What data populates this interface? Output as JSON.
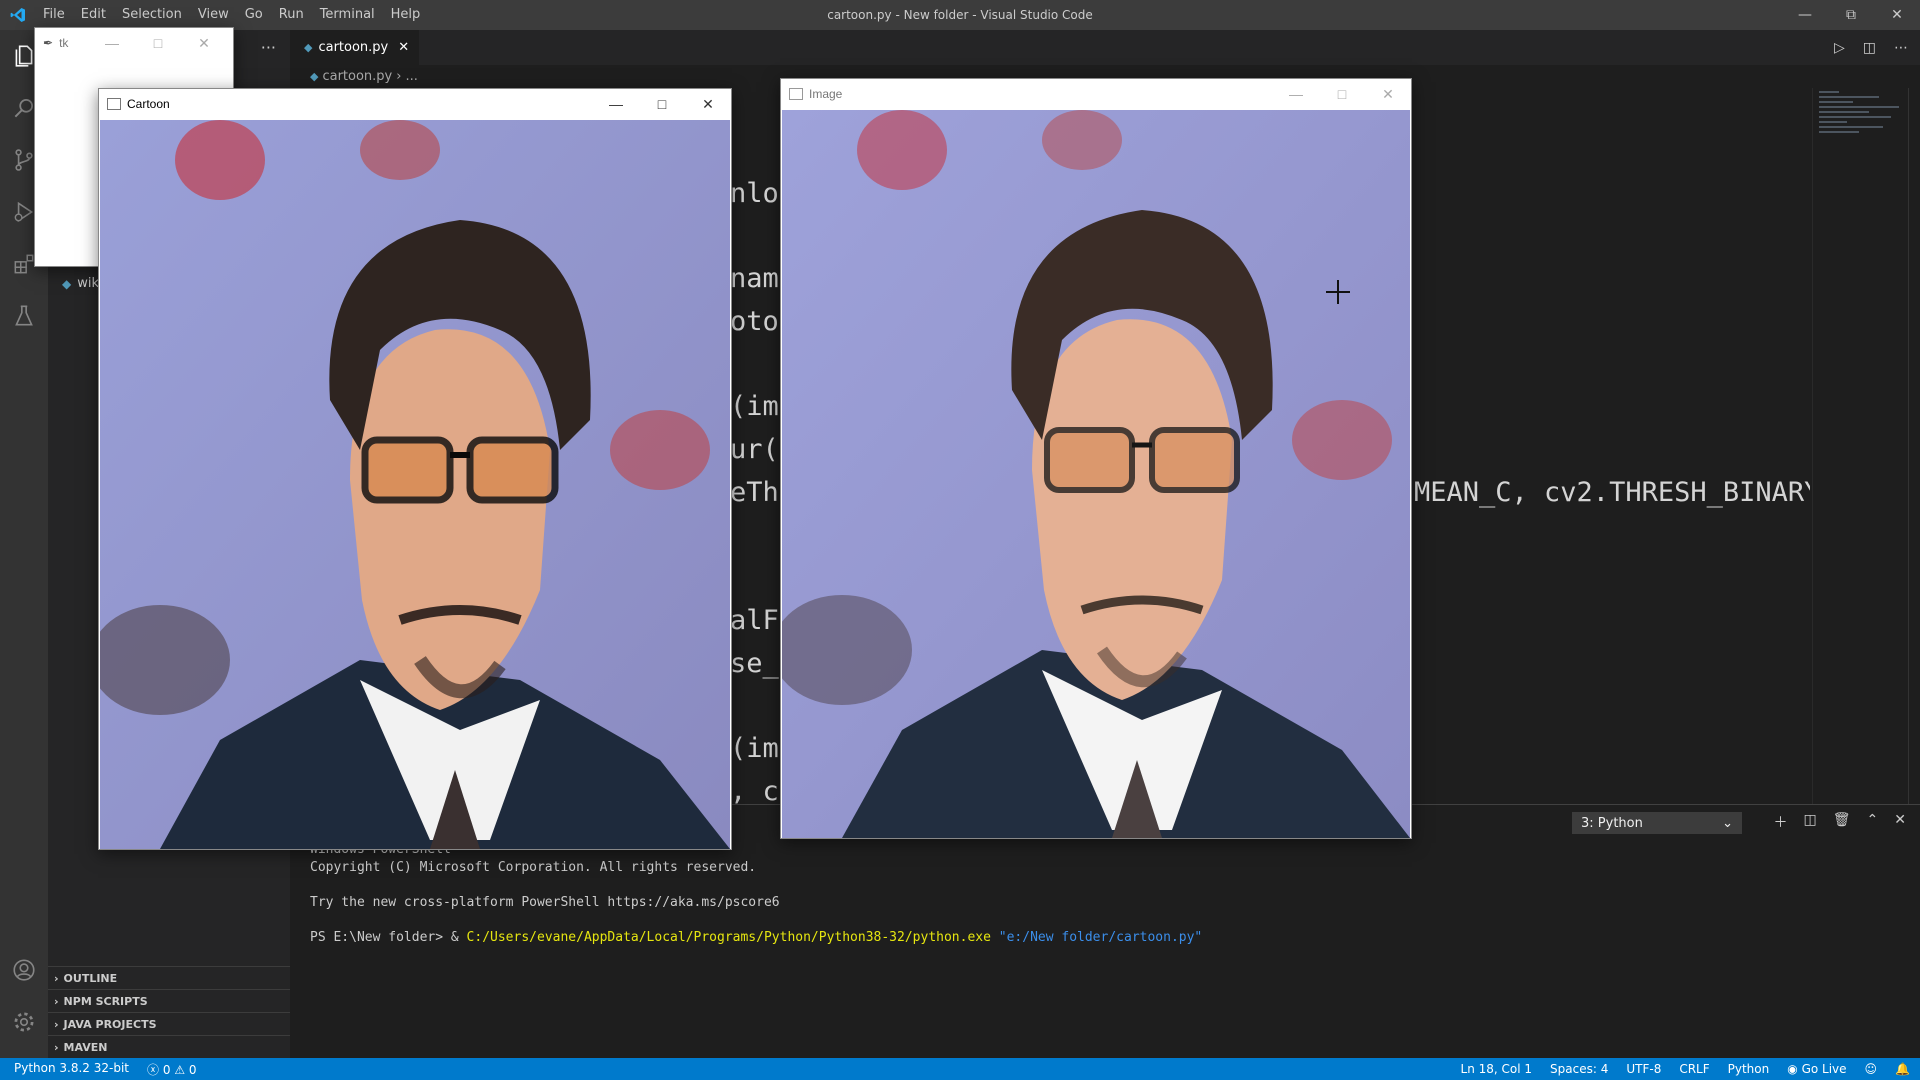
{
  "titlebar": {
    "title": "cartoon.py - New folder - Visual Studio Code",
    "menu": [
      "File",
      "Edit",
      "Selection",
      "View",
      "Go",
      "Run",
      "Terminal",
      "Help"
    ]
  },
  "sidebar": {
    "more": "···",
    "wiki_item": "wik",
    "sections": [
      "OUTLINE",
      "NPM SCRIPTS",
      "JAVA PROJECTS",
      "MAVEN"
    ]
  },
  "editor": {
    "tab_label": "cartoon.py",
    "breadcrumb_file": "cartoon.py",
    "breadcrumb_more": "...",
    "code_fragments": [
      "nlog",
      "name",
      "oto)",
      "(img",
      "ur(g",
      "eThr",
      "MEAN_C, cv2.THRESH_BINARY",
      "alFi",
      "se_a",
      "(img",
      ", c"
    ]
  },
  "panel": {
    "terminal_select": "3: Python",
    "lines": {
      "l0": "Windows PowerShell",
      "l1": "Copyright (C) Microsoft Corporation. All rights reserved.",
      "l2": "Try the new cross-platform PowerShell https://aka.ms/pscore6",
      "prompt": "PS E:\\New folder> & ",
      "exe": "C:/Users/evane/AppData/Local/Programs/Python/Python38-32/python.exe",
      "arg": "\"e:/New folder/cartoon.py\""
    }
  },
  "statusbar": {
    "python": "Python 3.8.2 32-bit",
    "errors": "0",
    "warnings": "0",
    "position": "Ln 18, Col 1",
    "spaces": "Spaces: 4",
    "encoding": "UTF-8",
    "eol": "CRLF",
    "language": "Python",
    "golive": "Go Live"
  },
  "windows": {
    "tk_title": "tk",
    "cartoon_title": "Cartoon",
    "image_title": "Image"
  },
  "colors": {
    "accent": "#007acc",
    "titlebar": "#3c3c3c",
    "editor_bg": "#1e1e1e",
    "sidebar_bg": "#252526"
  }
}
